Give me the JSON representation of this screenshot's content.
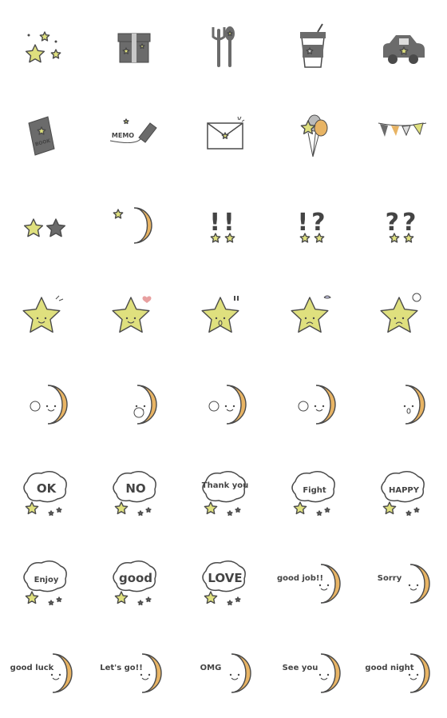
{
  "colors": {
    "star": "#dfe07e",
    "moon": "#e8b464",
    "ink": "#4a4a4a",
    "gray": "#6b6b6b",
    "light": "#c8c8c8"
  },
  "stickers": [
    {
      "icon": "star-cluster-icon",
      "kind": "cluster"
    },
    {
      "icon": "gift-box-icon",
      "kind": "gift"
    },
    {
      "icon": "fork-spoon-icon",
      "kind": "cutlery"
    },
    {
      "icon": "coffee-cup-icon",
      "kind": "coffee"
    },
    {
      "icon": "car-icon",
      "kind": "car"
    },
    {
      "icon": "book-icon",
      "kind": "book",
      "text": "BOOK"
    },
    {
      "icon": "memo-pencil-icon",
      "kind": "memo",
      "text": "MEMO"
    },
    {
      "icon": "envelope-icon",
      "kind": "envelope"
    },
    {
      "icon": "balloons-icon",
      "kind": "balloons"
    },
    {
      "icon": "bunting-flags-icon",
      "kind": "bunting"
    },
    {
      "icon": "two-stars-icon",
      "kind": "twostars"
    },
    {
      "icon": "crescent-moon-star-icon",
      "kind": "moonstar"
    },
    {
      "icon": "double-exclamation-stars-icon",
      "kind": "marks",
      "text": "!!"
    },
    {
      "icon": "exclamation-question-stars-icon",
      "kind": "marks",
      "text": "!?"
    },
    {
      "icon": "double-question-stars-icon",
      "kind": "marks",
      "text": "??"
    },
    {
      "icon": "star-smile-icon",
      "kind": "starface",
      "mood": "smile"
    },
    {
      "icon": "star-heart-icon",
      "kind": "starface",
      "mood": "love"
    },
    {
      "icon": "star-surprised-icon",
      "kind": "starface",
      "mood": "surprised"
    },
    {
      "icon": "star-worried-icon",
      "kind": "starface",
      "mood": "worried"
    },
    {
      "icon": "star-sad-icon",
      "kind": "starface",
      "mood": "sad"
    },
    {
      "icon": "moon-waving-icon",
      "kind": "moonface",
      "mood": "wave"
    },
    {
      "icon": "moon-peeking-icon",
      "kind": "moonface",
      "mood": "peek"
    },
    {
      "icon": "moon-thumbs-up-icon",
      "kind": "moonface",
      "mood": "thumb"
    },
    {
      "icon": "moon-pointing-icon",
      "kind": "moonface",
      "mood": "point"
    },
    {
      "icon": "moon-yawning-icon",
      "kind": "moonface",
      "mood": "yawn"
    },
    {
      "icon": "ok-bubble-icon",
      "kind": "bubble",
      "text": "OK"
    },
    {
      "icon": "no-bubble-icon",
      "kind": "bubble",
      "text": "NO"
    },
    {
      "icon": "thank-you-bubble-icon",
      "kind": "bubble",
      "text": "Thank you"
    },
    {
      "icon": "fight-bubble-icon",
      "kind": "bubble",
      "text": "Fight"
    },
    {
      "icon": "happy-bubble-icon",
      "kind": "bubble",
      "text": "HAPPY"
    },
    {
      "icon": "enjoy-bubble-icon",
      "kind": "bubble",
      "text": "Enjoy"
    },
    {
      "icon": "good-bubble-icon",
      "kind": "bubble",
      "text": "good"
    },
    {
      "icon": "love-bubble-icon",
      "kind": "bubble",
      "text": "LOVE"
    },
    {
      "icon": "good-job-moon-icon",
      "kind": "moontext",
      "text": "good job!!"
    },
    {
      "icon": "sorry-moon-icon",
      "kind": "moontext",
      "text": "Sorry"
    },
    {
      "icon": "good-luck-moon-icon",
      "kind": "moontext",
      "text": "good luck"
    },
    {
      "icon": "lets-go-moon-icon",
      "kind": "moontext",
      "text": "Let's go!!"
    },
    {
      "icon": "omg-moon-icon",
      "kind": "moontext",
      "text": "OMG"
    },
    {
      "icon": "see-you-moon-icon",
      "kind": "moontext",
      "text": "See you"
    },
    {
      "icon": "good-night-moon-icon",
      "kind": "moontext",
      "text": "good night"
    }
  ]
}
